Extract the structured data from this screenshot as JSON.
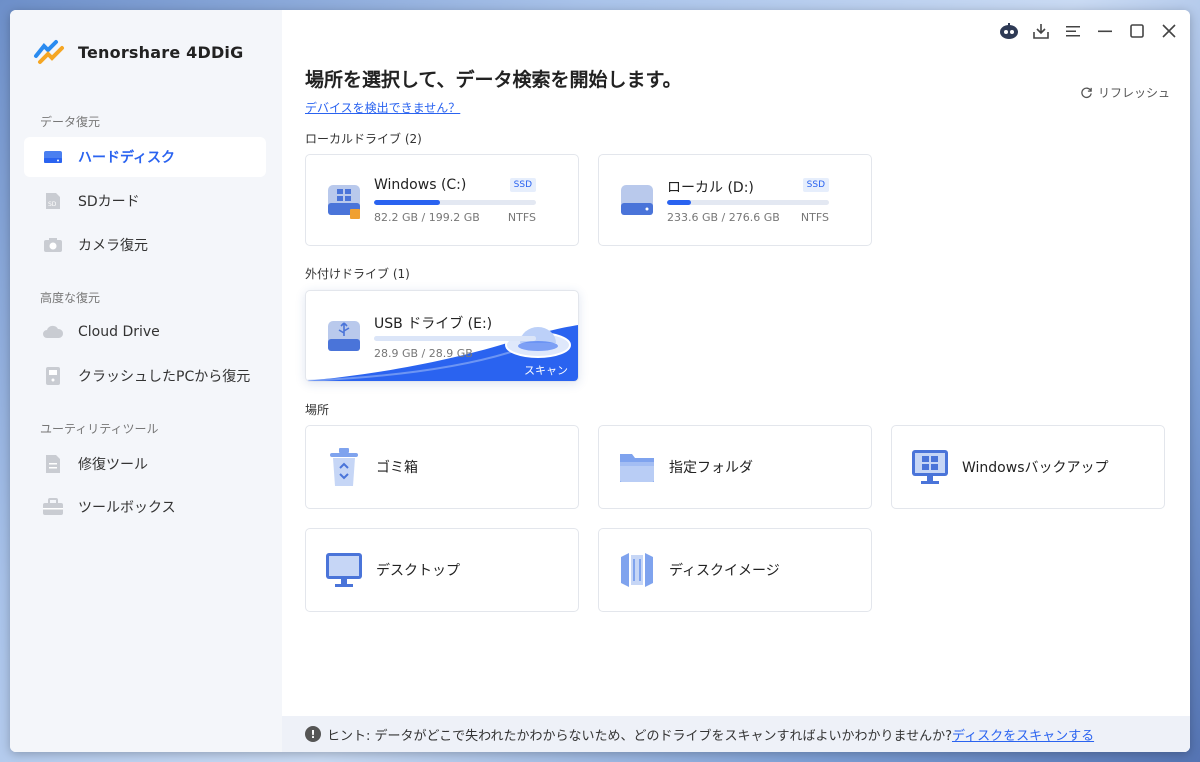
{
  "app": {
    "name": "Tenorshare 4DDiG"
  },
  "sidebar": {
    "sections": [
      {
        "title": "データ復元",
        "items": [
          {
            "label": "ハードディスク",
            "icon": "hard-disk-icon"
          },
          {
            "label": "SDカード",
            "icon": "sd-card-icon"
          },
          {
            "label": "カメラ復元",
            "icon": "camera-icon"
          }
        ]
      },
      {
        "title": "高度な復元",
        "items": [
          {
            "label": "Cloud Drive",
            "icon": "cloud-icon"
          },
          {
            "label": "クラッシュしたPCから復元",
            "icon": "crashed-pc-icon"
          }
        ]
      },
      {
        "title": "ユーティリティツール",
        "items": [
          {
            "label": "修復ツール",
            "icon": "repair-icon"
          },
          {
            "label": "ツールボックス",
            "icon": "toolbox-icon"
          }
        ]
      }
    ],
    "active_item": "ハードディスク"
  },
  "main": {
    "title": "場所を選択して、データ検索を開始します。",
    "device_link": "デバイスを検出できません？",
    "refresh_label": "リフレッシュ",
    "local_drives_label": "ローカルドライブ (2)",
    "external_drives_label": "外付けドライブ (1)",
    "locations_label": "場所",
    "drives": [
      {
        "name": "Windows (C:)",
        "badge": "SSD",
        "size": "82.2 GB / 199.2 GB",
        "fs": "NTFS",
        "usage": 0.41
      },
      {
        "name": "ローカル (D:)",
        "badge": "SSD",
        "size": "233.6 GB / 276.6 GB",
        "fs": "NTFS",
        "usage": 0.15
      }
    ],
    "external": {
      "name": "USB ドライブ (E:)",
      "size": "28.9 GB / 28.9 GB",
      "scan_label": "スキャン",
      "usage": 1.0
    },
    "locations": [
      {
        "label": "ゴミ箱",
        "icon": "recycle-bin-icon"
      },
      {
        "label": "指定フォルダ",
        "icon": "folder-icon"
      },
      {
        "label": "Windowsバックアップ",
        "icon": "windows-backup-icon"
      },
      {
        "label": "デスクトップ",
        "icon": "desktop-icon"
      },
      {
        "label": "ディスクイメージ",
        "icon": "disk-image-icon"
      }
    ]
  },
  "hint": {
    "text": "ヒント: データがどこで失われたかわからないため、どのドライブをスキャンすればよいかわかりませんか?",
    "link": "ディスクをスキャンする"
  },
  "colors": {
    "accent": "#2a63f0",
    "sidebar_bg": "#f4f6fa"
  }
}
